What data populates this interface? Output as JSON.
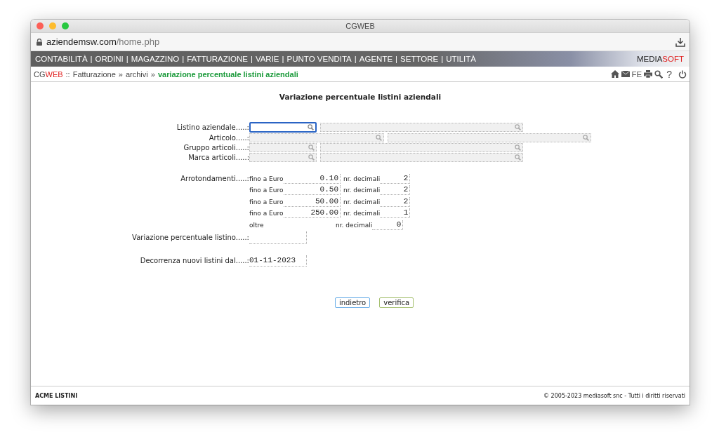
{
  "window": {
    "title": "CGWEB"
  },
  "address": {
    "host": "aziendemsw.com",
    "path": "/home.php"
  },
  "menu": {
    "items": [
      "CONTABILITÀ",
      "ORDINI",
      "MAGAZZINO",
      "FATTURAZIONE",
      "VARIE",
      "PUNTO VENDITA",
      "AGENTE",
      "SETTORE",
      "UTILITÀ"
    ],
    "separator": "|",
    "brand": [
      "MEDIA",
      "SOFT"
    ]
  },
  "breadcrumb": {
    "app": [
      "CG",
      "WEB"
    ],
    "separator": "::",
    "items": [
      "Fatturazione",
      "archivi"
    ],
    "arrow": "»",
    "current": "variazione percentuale listini aziendali"
  },
  "toolbar_texts": [
    "FE",
    "?"
  ],
  "form": {
    "title": "Variazione percentuale listini aziendali",
    "lookups": [
      {
        "label": "Listino aziendale.....:",
        "inputs": [
          {
            "kind": "short",
            "focused": true
          },
          {
            "kind": "long",
            "focused": false
          }
        ]
      },
      {
        "label": "Articolo.....:",
        "inputs": [
          {
            "kind": "medium",
            "focused": false
          },
          {
            "kind": "wide",
            "focused": false
          }
        ]
      },
      {
        "label": "Gruppo articoli.....:",
        "inputs": [
          {
            "kind": "short",
            "focused": false
          },
          {
            "kind": "long",
            "focused": false
          }
        ]
      },
      {
        "label": "Marca articoli.....:",
        "inputs": [
          {
            "kind": "short",
            "focused": false
          },
          {
            "kind": "long",
            "focused": false
          }
        ]
      }
    ],
    "rounding": {
      "label": "Arrotondamenti.....:",
      "rows": [
        {
          "kind": "upto",
          "label": "fino a Euro",
          "amount": "0.10",
          "decimals_label": "nr. decimali",
          "decimals": "2"
        },
        {
          "kind": "upto",
          "label": "fino a Euro",
          "amount": "0.50",
          "decimals_label": "nr. decimali",
          "decimals": "2"
        },
        {
          "kind": "upto",
          "label": "fino a Euro",
          "amount": "50.00",
          "decimals_label": "nr. decimali",
          "decimals": "2"
        },
        {
          "kind": "upto",
          "label": "fino a Euro",
          "amount": "250.00",
          "decimals_label": "nr. decimali",
          "decimals": "1"
        },
        {
          "kind": "over",
          "label": "oltre",
          "decimals_label": "nr. decimali",
          "decimals": "0"
        }
      ]
    },
    "percent": {
      "label": "Variazione percentuale listino.....:"
    },
    "start_date": {
      "label": "Decorrenza nuovi listini dal.....:",
      "value": "01-11-2023"
    },
    "buttons": [
      {
        "label": "indietro",
        "color": "#6aaee8"
      },
      {
        "label": "verifica",
        "color": "#a6c070"
      }
    ]
  },
  "footer": {
    "left": "ACME LISTINI",
    "right": "© 2005-2023 mediasoft snc - Tutti i diritti riservati"
  }
}
